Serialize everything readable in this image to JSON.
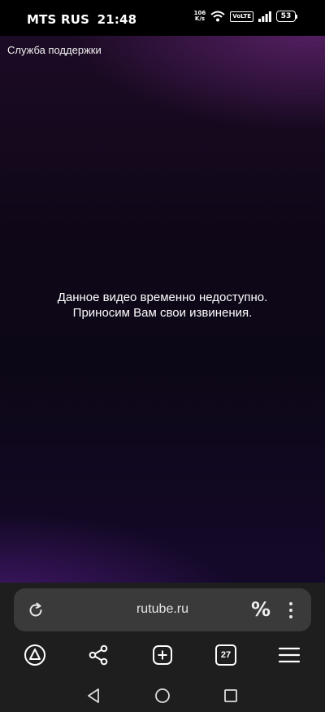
{
  "status_bar": {
    "carrier": "MTS RUS",
    "time": "21:48",
    "net_speed_value": "106",
    "net_speed_unit": "K/s",
    "volte": "VoLTE",
    "battery": "53",
    "icons": [
      "wifi-icon",
      "signal-icon",
      "battery-icon"
    ]
  },
  "page": {
    "support_link": "Служба поддержки",
    "message_line1": "Данное видео временно недоступно.",
    "message_line2": "Приносим Вам свои извинения."
  },
  "browser": {
    "url": "rutube.ru",
    "url_actions": [
      "reload-icon",
      "percent-icon",
      "menu-dots-icon"
    ],
    "toolbar": {
      "tabs_count": "27",
      "items": [
        "alice-icon",
        "share-icon",
        "new-tab-icon",
        "tabs-icon",
        "menu-icon"
      ]
    }
  },
  "system_nav": [
    "back-icon",
    "home-icon",
    "recents-icon"
  ]
}
